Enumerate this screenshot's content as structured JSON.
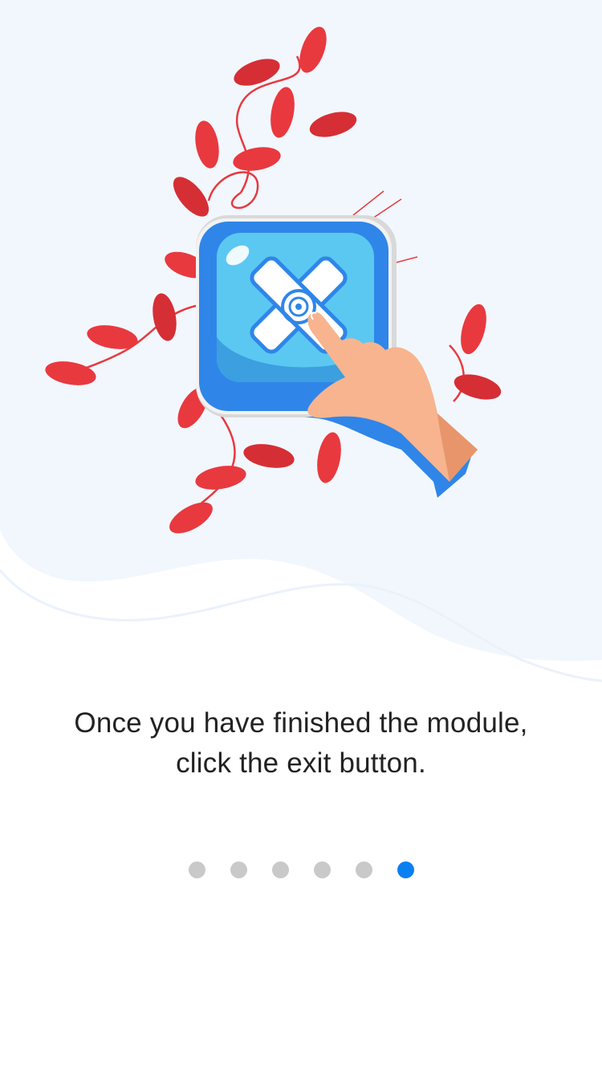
{
  "onboarding": {
    "illustration": {
      "icon": "exit-button-tap-icon",
      "description_icons": [
        "leaf-vine-icon",
        "x-button-icon",
        "pointing-hand-icon"
      ]
    },
    "caption": {
      "line1": "Once you have finished the module,",
      "line2": "click the exit button."
    },
    "pager": {
      "total": 6,
      "current": 6
    }
  },
  "colors": {
    "background": "#ffffff",
    "wave": "#f2f7fd",
    "leaf_red": "#e8393f",
    "button_blue": "#2f86e8",
    "button_face": "#5bc8f2",
    "dot_inactive": "#c9c9c9",
    "dot_active": "#0a7ff2",
    "text": "#222222"
  }
}
